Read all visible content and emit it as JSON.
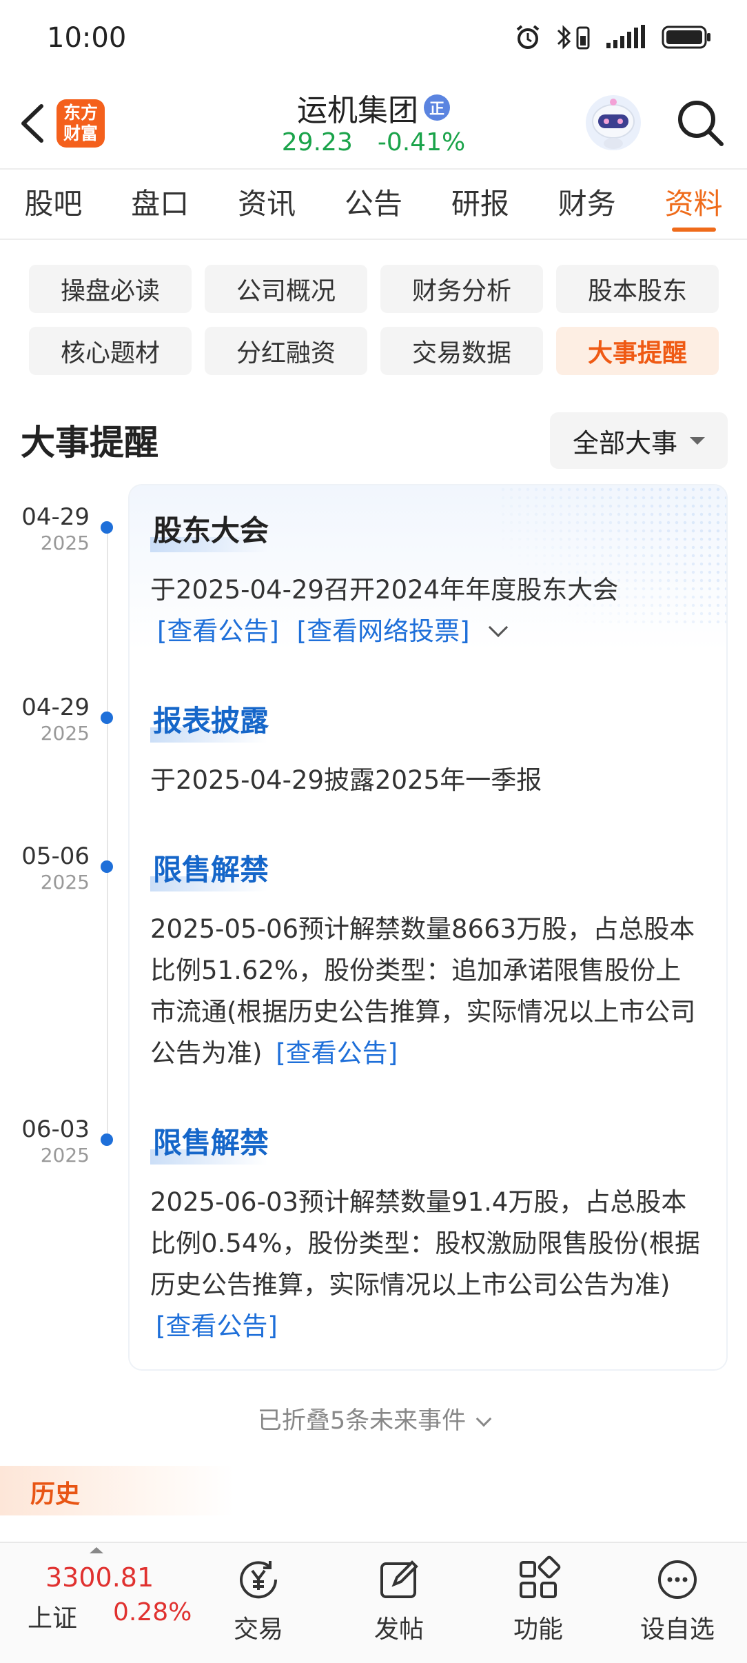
{
  "status_bar": {
    "time": "10:00"
  },
  "header": {
    "app_logo_text": "东方财富",
    "stock_name": "运机集团",
    "badge": "正",
    "price": "29.23",
    "change_pct": "-0.41%"
  },
  "tabs": [
    {
      "label": "股吧"
    },
    {
      "label": "盘口"
    },
    {
      "label": "资讯"
    },
    {
      "label": "公告"
    },
    {
      "label": "研报"
    },
    {
      "label": "财务"
    },
    {
      "label": "资料",
      "active": true
    }
  ],
  "subtags": [
    {
      "label": "操盘必读"
    },
    {
      "label": "公司概况"
    },
    {
      "label": "财务分析"
    },
    {
      "label": "股本股东"
    },
    {
      "label": "核心题材"
    },
    {
      "label": "分红融资"
    },
    {
      "label": "交易数据"
    },
    {
      "label": "大事提醒",
      "active": true
    }
  ],
  "section": {
    "title": "大事提醒",
    "filter_label": "全部大事"
  },
  "events": [
    {
      "date_md": "04-29",
      "date_year": "2025",
      "title": "股东大会",
      "body": "于2025-04-29召开2024年年度股东大会",
      "link1": "[查看公告]",
      "link2": "[查看网络投票]"
    },
    {
      "date_md": "04-29",
      "date_year": "2025",
      "title": "报表披露",
      "body": "于2025-04-29披露2025年一季报"
    },
    {
      "date_md": "05-06",
      "date_year": "2025",
      "title": "限售解禁",
      "body": "2025-05-06预计解禁数量8663万股，占总股本比例51.62%，股份类型：追加承诺限售股份上市流通(根据历史公告推算，实际情况以上市公司公告为准)",
      "link1": "[查看公告]"
    },
    {
      "date_md": "06-03",
      "date_year": "2025",
      "title": "限售解禁",
      "body": "2025-06-03预计解禁数量91.4万股，占总股本比例0.54%，股份类型：股权激励限售股份(根据历史公告推算，实际情况以上市公司公告为准)",
      "link1": "[查看公告]"
    }
  ],
  "folded_text": "已折叠5条未来事件",
  "history_label": "历史",
  "bottom_nav": {
    "index_value": "3300.81",
    "index_name": "上证",
    "index_change": "0.28%",
    "items": [
      {
        "label": "交易"
      },
      {
        "label": "发帖"
      },
      {
        "label": "功能"
      },
      {
        "label": "设自选"
      }
    ]
  },
  "colors": {
    "accent": "#ef6b1a",
    "link": "#1e6fd9",
    "down": "#1aa34a",
    "up": "#e0312f"
  }
}
